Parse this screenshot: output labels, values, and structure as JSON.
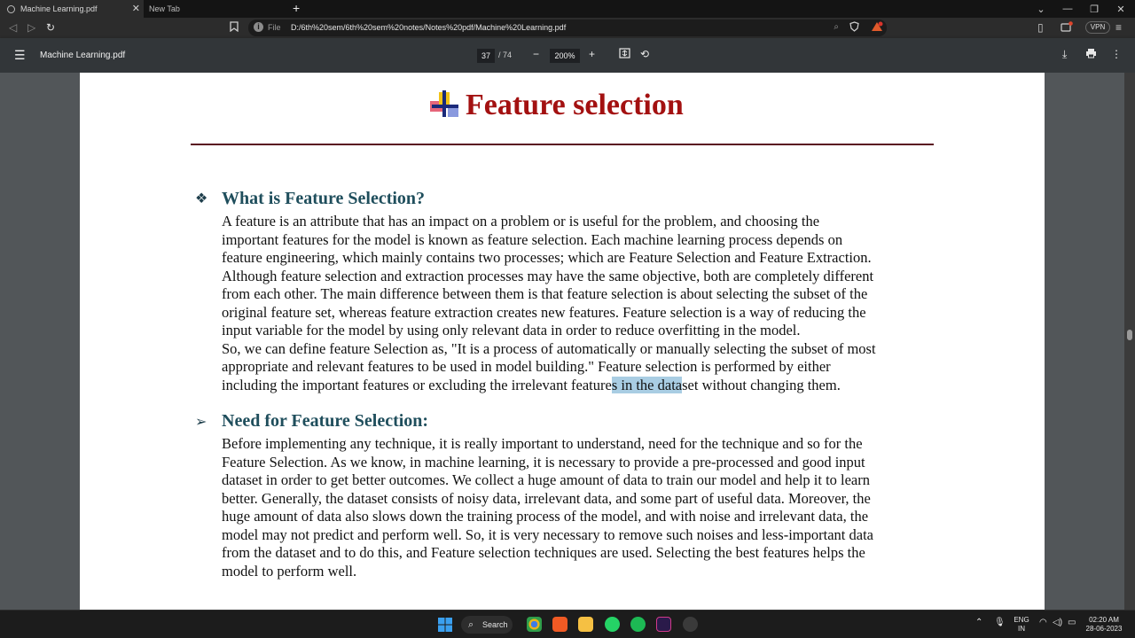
{
  "browser": {
    "tabs": [
      {
        "label": "Machine Learning.pdf",
        "active": true
      },
      {
        "label": "New Tab",
        "active": false
      }
    ],
    "address": {
      "scheme_label": "File",
      "url": "D:/6th%20sem/6th%20sem%20notes/Notes%20pdf/Machine%20Learning.pdf"
    },
    "vpn_label": "VPN"
  },
  "pdf_toolbar": {
    "title": "Machine Learning.pdf",
    "current_page": "37",
    "total_pages": "/ 74",
    "zoom": "200%"
  },
  "document": {
    "title": "Feature selection",
    "sections": [
      {
        "heading": "What is Feature Selection?",
        "bullet": "❖",
        "lines": [
          "A feature is an attribute that has an impact on a problem or is useful for the problem, and choosing the",
          "important features for the model is known as feature selection. Each machine learning process depends on",
          "feature engineering, which mainly contains two processes; which are Feature Selection and Feature Extraction.",
          "Although feature selection and extraction processes may have the same objective, both are completely different",
          "from each other. The main difference between them is that feature selection is about selecting the subset of the",
          "original feature set, whereas feature extraction creates new features. Feature selection is a way of reducing the",
          "input variable for the model by using only relevant data in order to reduce overfitting in the model.",
          "So, we can define feature Selection as, \"It is a process of automatically or manually selecting the subset of most",
          "appropriate and relevant features to be used in model building.\" Feature selection is performed by either"
        ],
        "last_line": {
          "before": "including the important features or excluding the irrelevant feature",
          "highlight": "s in the data",
          "after": "set without changing them."
        }
      },
      {
        "heading": "Need for Feature Selection:",
        "bullet": "➢",
        "lines": [
          "Before implementing any technique, it is really important to understand, need for the technique and so for the",
          "Feature Selection. As we know, in machine learning, it is necessary to provide a pre-processed and good input",
          "dataset in order to get better outcomes. We collect a huge amount of data to train our model and help it to learn",
          "better. Generally, the dataset consists of noisy data, irrelevant data, and some part of useful data. Moreover, the",
          "huge amount of data also slows down the training process of the model, and with noise and irrelevant data, the",
          "model may not predict and perform well. So, it is very necessary to remove such noises and less-important data",
          "from the dataset and to do this, and Feature selection techniques are used. Selecting the best features helps the",
          "model to perform well."
        ]
      }
    ]
  },
  "taskbar": {
    "search_label": "Search",
    "language": "ENG",
    "region": "IN",
    "time": "02:20 AM",
    "date": "28-06-2023"
  },
  "colors": {
    "title_red": "#a31111",
    "heading_teal": "#1f4e5c",
    "highlight": "#a9cde3"
  }
}
